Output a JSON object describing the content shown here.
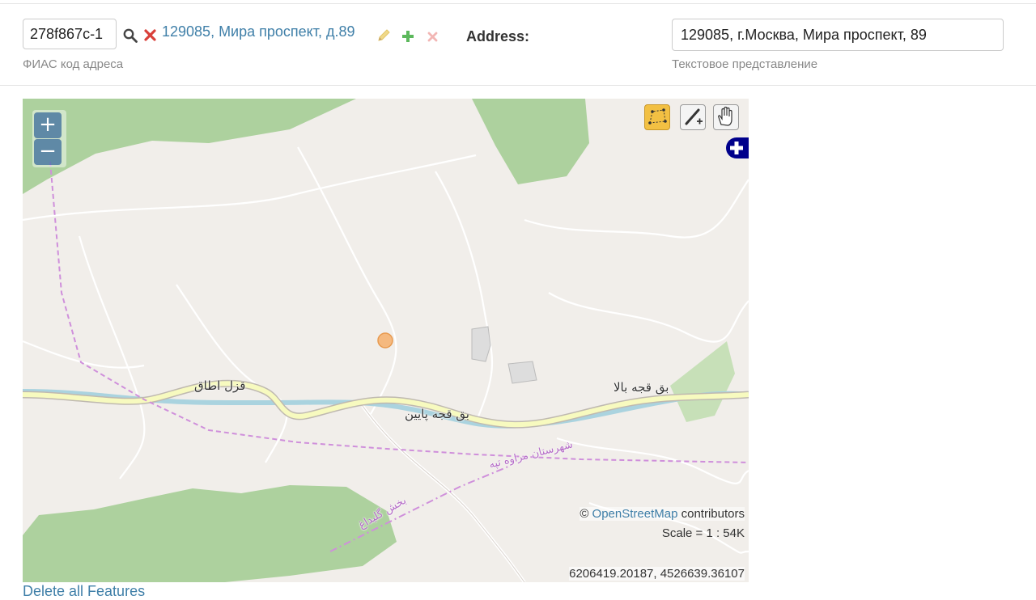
{
  "fias": {
    "value": "278f867c-1",
    "help": "ФИАС код адреса",
    "address_link": "129085, Мира проспект, д.89"
  },
  "address": {
    "label": "Address:",
    "value": "129085, г.Москва, Мира проспект, 89",
    "help": "Текстовое представление"
  },
  "map": {
    "zoom_in": "+",
    "zoom_out": "−",
    "attribution_prefix": "©",
    "attribution_link": "OpenStreetMap",
    "attribution_suffix": "contributors",
    "scale": "Scale = 1 : 54K",
    "coords": "6206419.20187, 4526639.36107",
    "places": [
      "قزل اطاق",
      "بق قجه پایین",
      "بق قجه بالا",
      "شهرستان مراوه تپه",
      "بخش گلیداغ"
    ],
    "colors": {
      "forest": "#add19e",
      "road": "#f7fabf",
      "river": "#aad3df",
      "boundary": "#cf8fdb",
      "marker": "#f5b97f"
    }
  },
  "actions": {
    "delete_all": "Delete all Features"
  }
}
